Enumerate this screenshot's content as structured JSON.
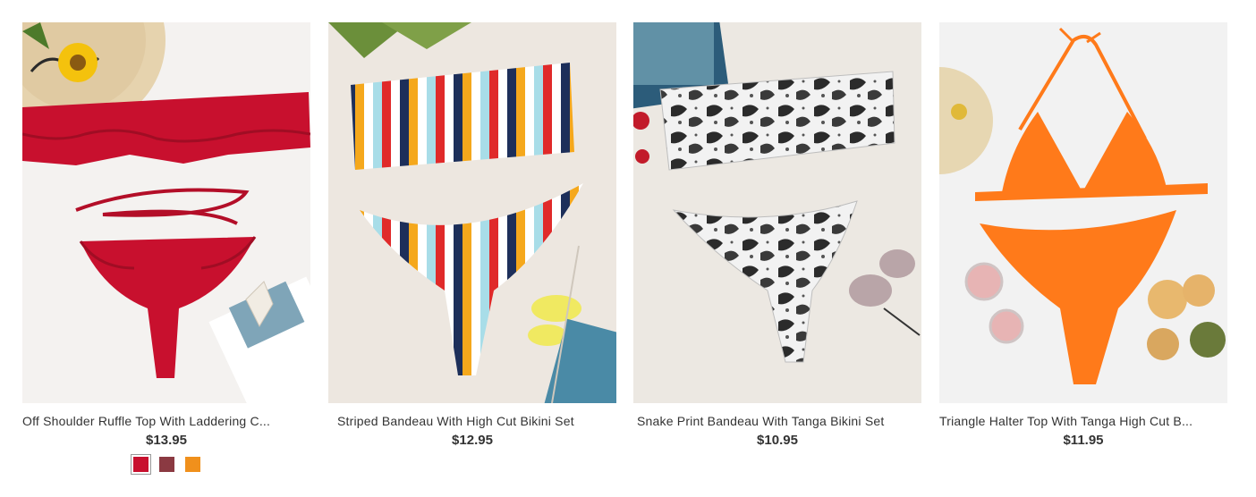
{
  "products": [
    {
      "title": "Off Shoulder Ruffle Top With Laddering C...",
      "price": "$13.95",
      "image_subject": "red-ruffle-bikini-photo",
      "background": "#f4f2f0",
      "swatches": [
        {
          "color": "#c8102e",
          "selected": true
        },
        {
          "color": "#8b3a42",
          "selected": false
        },
        {
          "color": "#f0901c",
          "selected": false
        }
      ]
    },
    {
      "title": "Striped Bandeau With High Cut Bikini Set",
      "price": "$12.95",
      "image_subject": "striped-bikini-photo",
      "background": "#ede7e0"
    },
    {
      "title": "Snake Print Bandeau With Tanga Bikini Set",
      "price": "$10.95",
      "image_subject": "snake-print-bikini-photo",
      "background": "#ece8e2"
    },
    {
      "title": "Triangle Halter Top With Tanga High Cut B...",
      "price": "$11.95",
      "image_subject": "orange-halter-bikini-photo",
      "background": "#f2f2f2"
    }
  ]
}
